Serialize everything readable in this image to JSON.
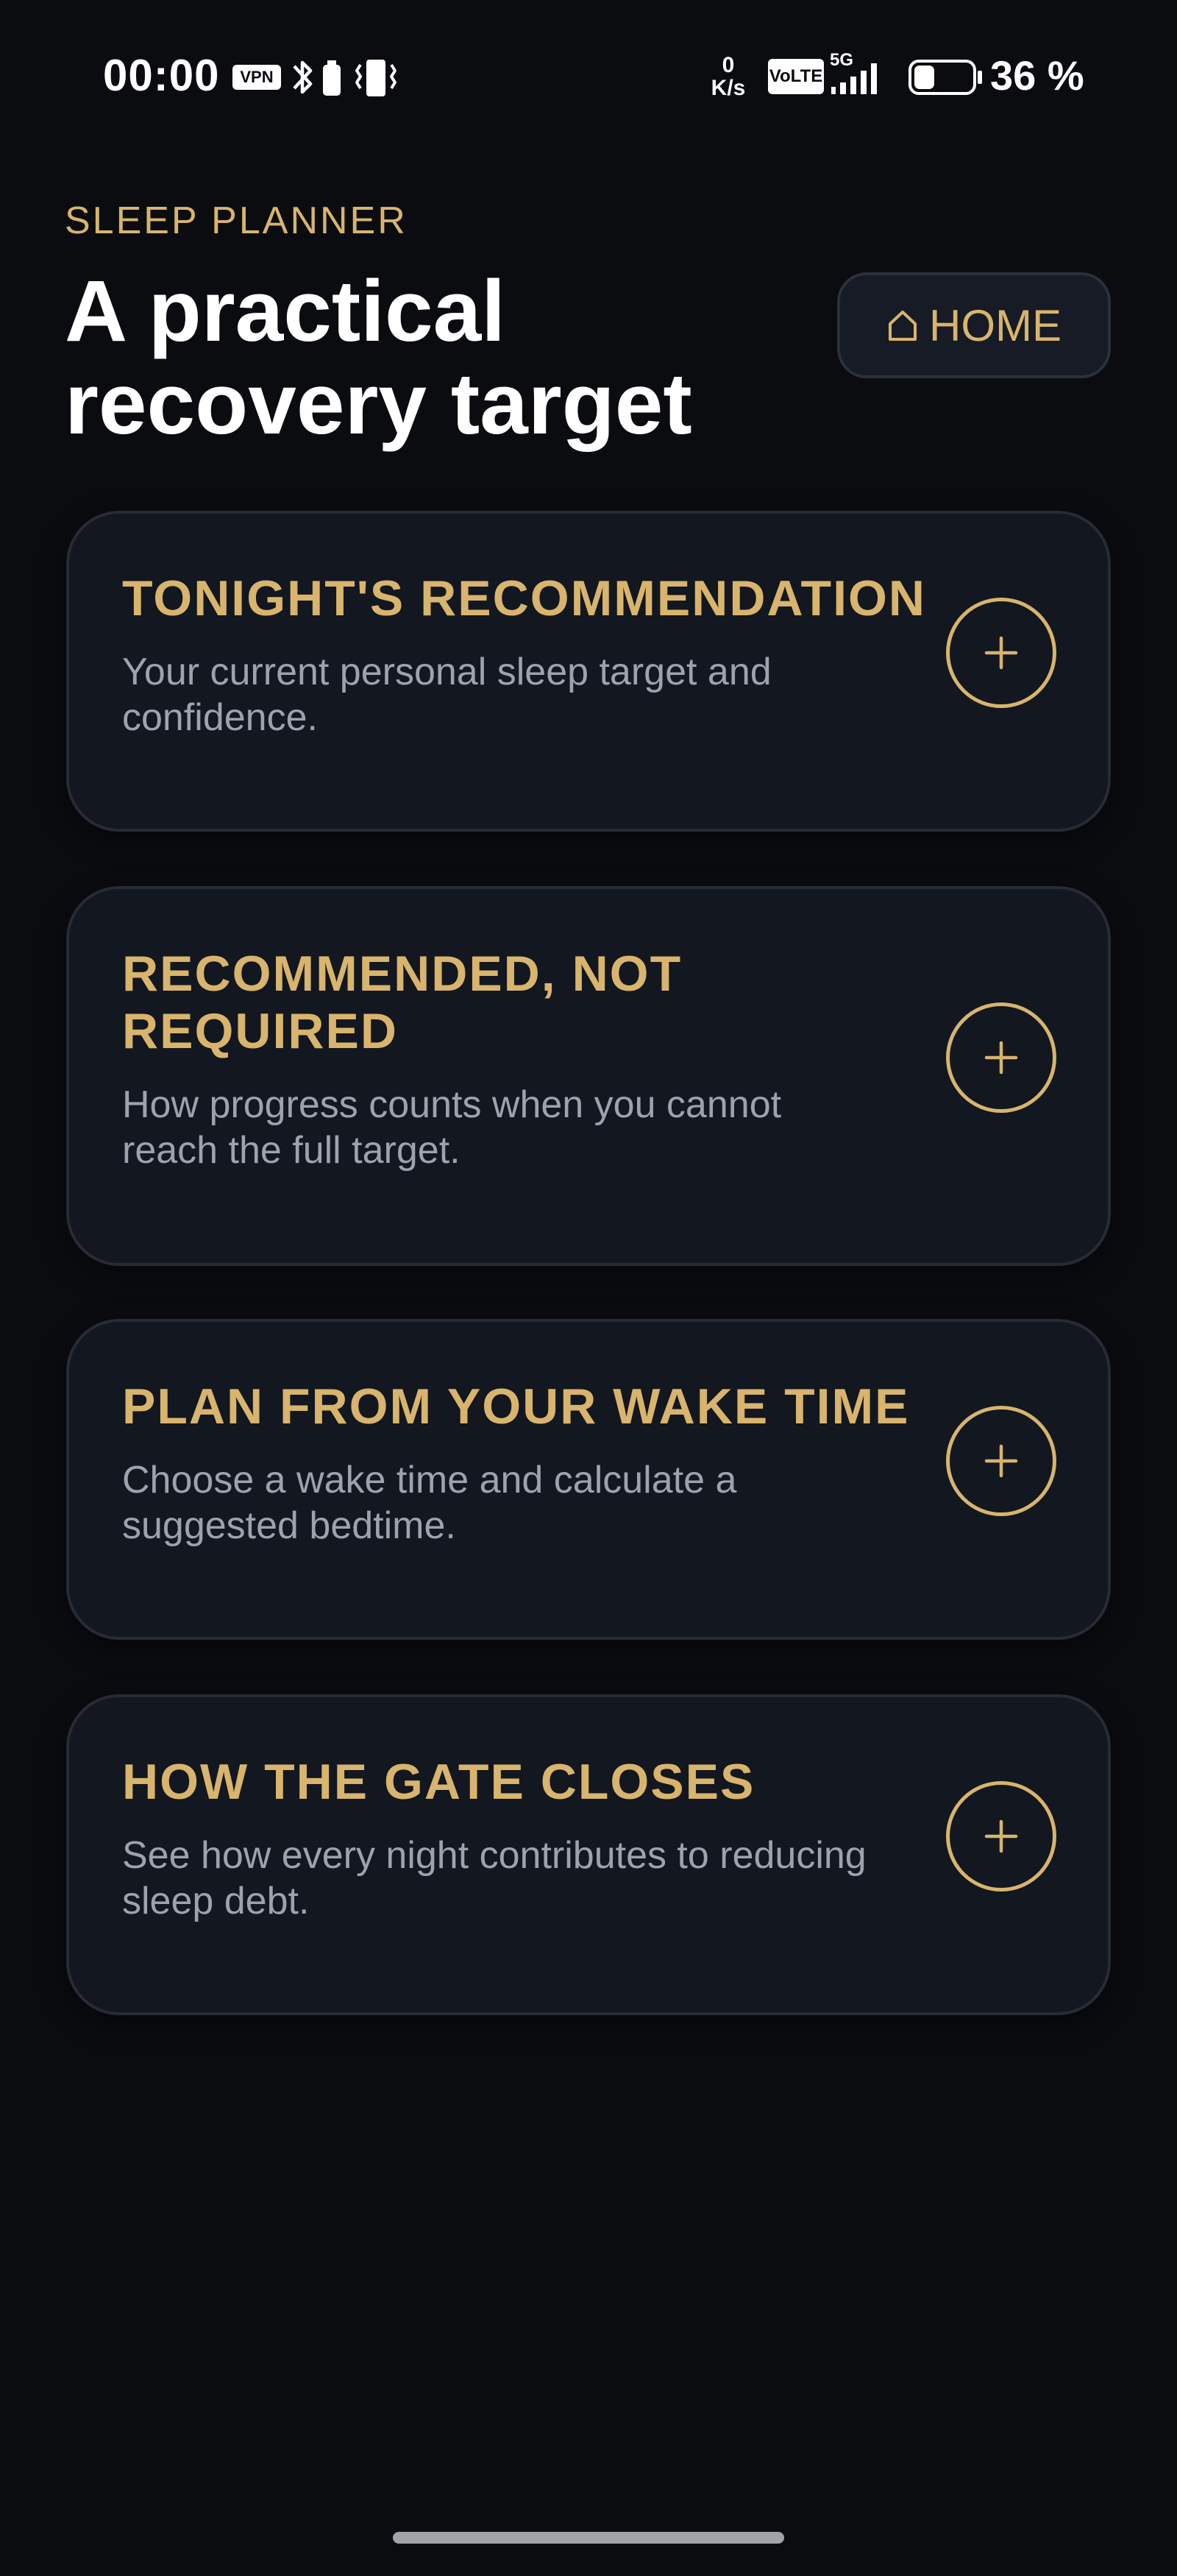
{
  "status_bar": {
    "time": "00:00",
    "vpn": "VPN",
    "net_speed_value": "0",
    "net_speed_unit": "K/s",
    "volte": "VoLTE",
    "network": "5G",
    "battery_percent": "36 %",
    "battery_level": 0.36,
    "icons": [
      "vpn-icon",
      "bluetooth-icon",
      "battery-saver-icon",
      "vibrate-icon",
      "volte-icon",
      "signal-icon",
      "battery-icon"
    ]
  },
  "header": {
    "eyebrow": "SLEEP PLANNER",
    "title": "A practical recovery target",
    "home_label": "HOME",
    "home_icon": "home-icon"
  },
  "cards": [
    {
      "title": "TONIGHT'S RECOMMENDATION",
      "description": "Your current personal sleep target and confidence.",
      "action_icon": "plus-icon"
    },
    {
      "title": "RECOMMENDED, NOT REQUIRED",
      "description": "How progress counts when you cannot reach the full target.",
      "action_icon": "plus-icon"
    },
    {
      "title": "PLAN FROM YOUR WAKE TIME",
      "description": "Choose a wake time and calculate a suggested bedtime.",
      "action_icon": "plus-icon"
    },
    {
      "title": "HOW THE GATE CLOSES",
      "description": "See how every night contributes to reducing sleep debt.",
      "action_icon": "plus-icon"
    }
  ],
  "colors": {
    "background": "#0a0c10",
    "card_background": "#121720",
    "card_border": "#262b35",
    "accent_gold": "#d8b46c",
    "text_primary": "#ffffff",
    "text_secondary": "#9ca3af"
  }
}
